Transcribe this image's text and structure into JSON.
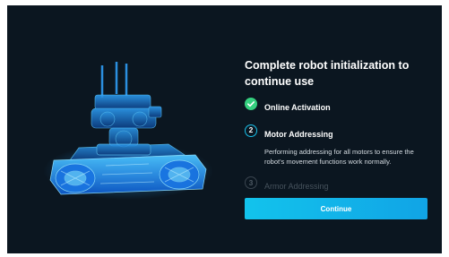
{
  "dialog": {
    "title": "Complete robot initialization to continue use",
    "steps": [
      {
        "number": "",
        "label": "Online Activation",
        "state": "done"
      },
      {
        "number": "2",
        "label": "Motor Addressing",
        "state": "active",
        "description": "Performing addressing for all motors to ensure the robot's movement functions work normally."
      },
      {
        "number": "3",
        "label": "Armor Addressing",
        "state": "pending"
      }
    ],
    "continue_label": "Continue"
  },
  "colors": {
    "background": "#0b1620",
    "accent": "#12c3ec",
    "success": "#35d07f",
    "robot_glow": "#1e8fff"
  },
  "icons": {
    "done_badge": "check-icon",
    "illustration": "robot-wireframe-illustration"
  }
}
